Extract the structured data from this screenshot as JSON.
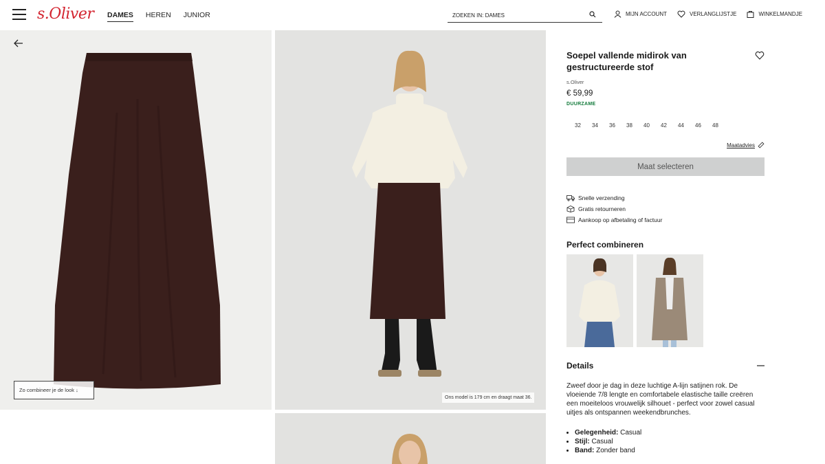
{
  "header": {
    "logo": "s.Oliver",
    "nav": [
      "DAMES",
      "HEREN",
      "JUNIOR"
    ],
    "search_placeholder": "ZOEKEN IN: DAMES",
    "account_label": "MIJN ACCOUNT",
    "wishlist_label": "VERLANGLIJSTJE",
    "cart_label": "WINKELMANDJE"
  },
  "gallery": {
    "combine_label": "Zo combineer je de look ↓",
    "model_note": "Ons model is 179 cm en draagt maat 36."
  },
  "product": {
    "title": "Soepel vallende midirok van gestructureerde stof",
    "brand": "s.Oliver",
    "price": "€ 59,99",
    "sustainability": "DUURZAME",
    "sizes": [
      "32",
      "34",
      "36",
      "38",
      "40",
      "42",
      "44",
      "46",
      "48"
    ],
    "size_advice": "Maatadvies",
    "select_button": "Maat selecteren",
    "usps": [
      "Snelle verzending",
      "Gratis retourneren",
      "Aankoop op afbetaling of factuur"
    ],
    "combine_title": "Perfect combineren",
    "details_title": "Details",
    "details_text": "Zweef door je dag in deze luchtige A-lijn satijnen rok. De vloeiende 7/8 lengte en comfortabele elastische taille creëren een moeiteloos vrouwelijk silhouet - perfect voor zowel casual uitjes als ontspannen weekendbrunches.",
    "attributes": [
      {
        "key": "Gelegenheid:",
        "value": "Casual"
      },
      {
        "key": "Stijl:",
        "value": "Casual"
      },
      {
        "key": "Band:",
        "value": "Zonder band"
      }
    ]
  },
  "colors": {
    "brand_red": "#d3242f",
    "skirt_brown": "#3a1f1c",
    "sustain_green": "#127a3a",
    "button_grey": "#cfd0d0"
  }
}
